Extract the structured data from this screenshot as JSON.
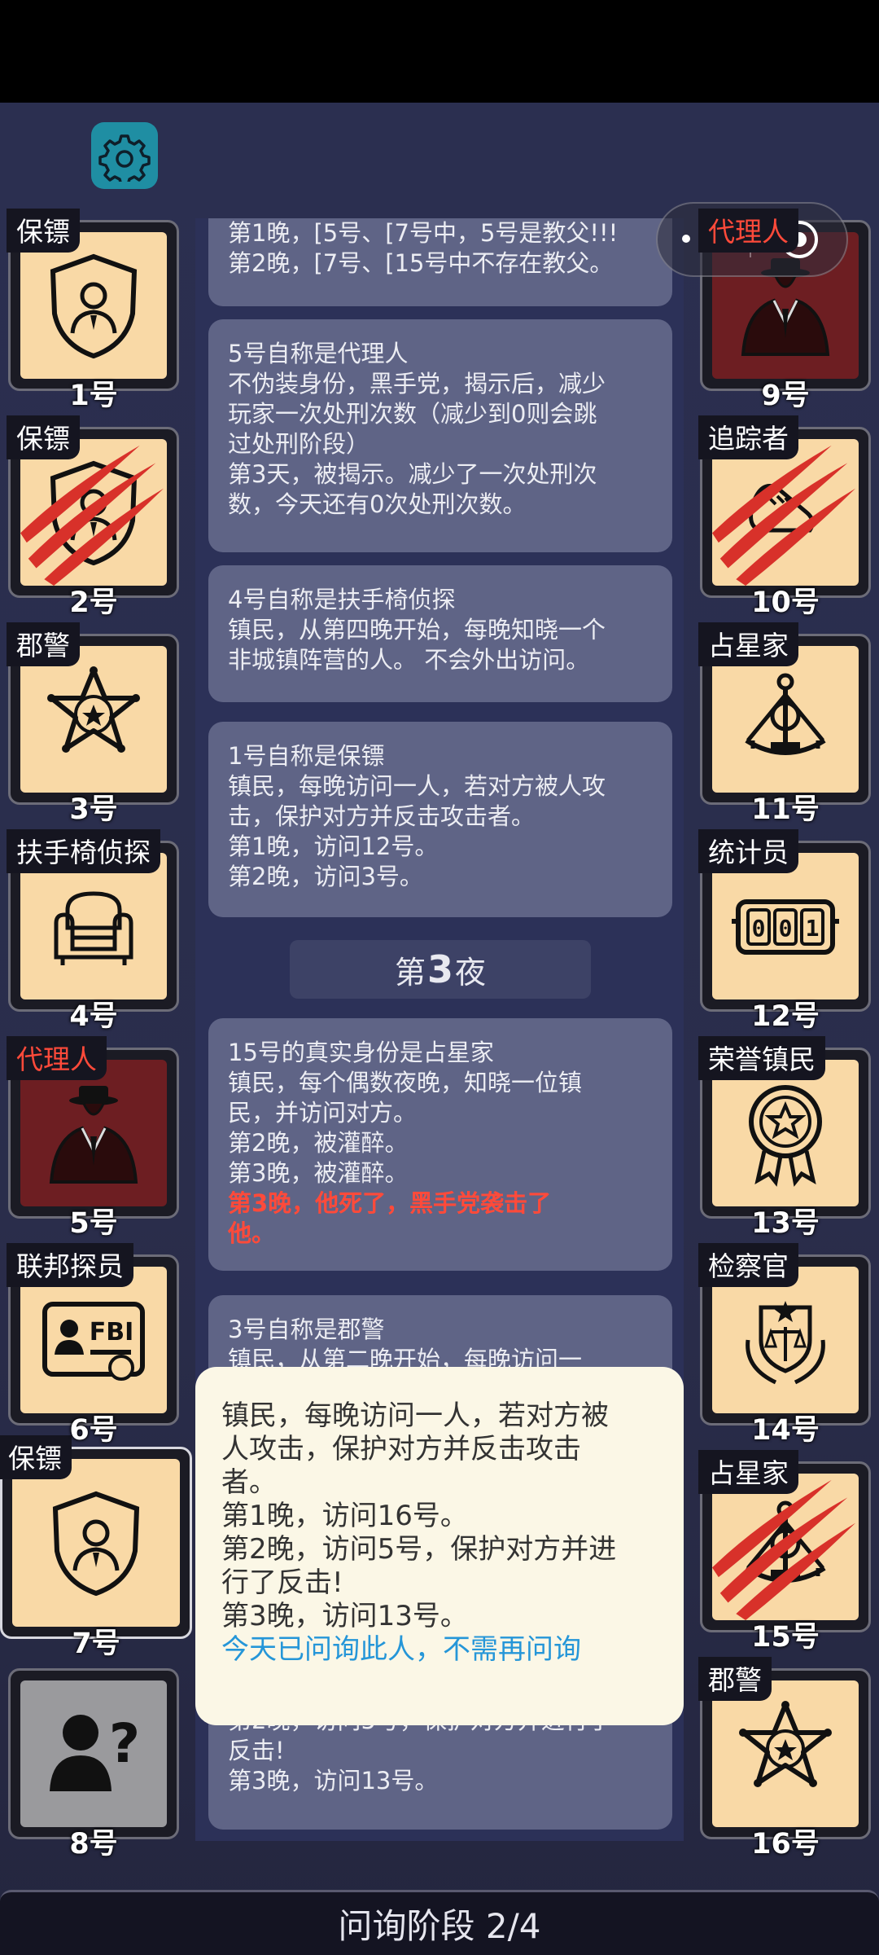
{
  "settings": {
    "icon": "gear-icon"
  },
  "capsule": {
    "menu_icon": "more-dots-icon",
    "close_icon": "record-icon"
  },
  "players_left": [
    {
      "role": "保镖",
      "number": "1号",
      "icon": "bodyguard-shield-icon",
      "role_color": "white",
      "bg": "light",
      "clawed": false
    },
    {
      "role": "保镖",
      "number": "2号",
      "icon": "bodyguard-shield-icon",
      "role_color": "white",
      "bg": "light",
      "clawed": true
    },
    {
      "role": "郡警",
      "number": "3号",
      "icon": "sheriff-badge-icon",
      "role_color": "white",
      "bg": "light",
      "clawed": false
    },
    {
      "role": "扶手椅侦探",
      "number": "4号",
      "icon": "armchair-icon",
      "role_color": "white",
      "bg": "light",
      "clawed": false
    },
    {
      "role": "代理人",
      "number": "5号",
      "icon": "mafia-agent-icon",
      "role_color": "red",
      "bg": "dark",
      "clawed": false
    },
    {
      "role": "联邦探员",
      "number": "6号",
      "icon": "fbi-badge-icon",
      "role_color": "white",
      "bg": "light",
      "clawed": false
    },
    {
      "role": "保镖",
      "number": "7号",
      "icon": "bodyguard-shield-icon",
      "role_color": "white",
      "bg": "light",
      "clawed": false
    },
    {
      "role": "",
      "number": "8号",
      "icon": "unknown-person-icon",
      "role_color": "white",
      "bg": "grey",
      "clawed": false
    }
  ],
  "players_right": [
    {
      "role": "代理人",
      "number": "9号",
      "icon": "mafia-agent-icon",
      "role_color": "red",
      "bg": "dark",
      "clawed": false
    },
    {
      "role": "追踪者",
      "number": "10号",
      "icon": "tracker-shoes-icon",
      "role_color": "white",
      "bg": "light",
      "clawed": true
    },
    {
      "role": "占星家",
      "number": "11号",
      "icon": "sextant-icon",
      "role_color": "white",
      "bg": "light",
      "clawed": false
    },
    {
      "role": "统计员",
      "number": "12号",
      "icon": "counter-icon",
      "role_color": "white",
      "bg": "light",
      "clawed": false
    },
    {
      "role": "荣誉镇民",
      "number": "13号",
      "icon": "medal-icon",
      "role_color": "white",
      "bg": "light",
      "clawed": false
    },
    {
      "role": "检察官",
      "number": "14号",
      "icon": "justice-scales-icon",
      "role_color": "white",
      "bg": "light",
      "clawed": false
    },
    {
      "role": "占星家",
      "number": "15号",
      "icon": "sextant-icon",
      "role_color": "white",
      "bg": "light",
      "clawed": true
    },
    {
      "role": "郡警",
      "number": "16号",
      "icon": "sheriff-badge-icon",
      "role_color": "white",
      "bg": "light",
      "clawed": false
    }
  ],
  "feed": {
    "card1": [
      "第1晚，[5号、[7号中，5号是教父!!!",
      "第2晚，[7号、[15号中不存在教父。"
    ],
    "card2": [
      "5号自称是代理人",
      "不伪装身份，黑手党，揭示后，减少",
      "玩家一次处刑次数（减少到0则会跳",
      "过处刑阶段）",
      "第3天，被揭示。减少了一次处刑次",
      "数，今天还有0次处刑次数。"
    ],
    "card3": [
      "4号自称是扶手椅侦探",
      "镇民，从第四晚开始，每晚知晓一个",
      "非城镇阵营的人。 不会外出访问。"
    ],
    "card4": [
      "1号自称是保镖",
      "镇民，每晚访问一人，若对方被人攻",
      "击，保护对方并反击攻击者。",
      "第1晚，访问12号。",
      "第2晚，访问3号。"
    ],
    "night_prefix": "第",
    "night_number": "3",
    "night_suffix": "夜",
    "card5": [
      "15号的真实身份是占星家",
      "镇民，每个偶数夜晚，知晓一位镇",
      "民，并访问对方。",
      "第2晚，被灌醉。",
      "第3晚，被灌醉。"
    ],
    "card5_red": [
      "第3晚，他死了，黑手党袭击了",
      "他。"
    ],
    "card6": [
      "3号自称是郡警",
      "镇民，从第二晚开始，每晚访问一"
    ],
    "card7": [
      "第2晚，访问5号，保护对方并进行了",
      "反击!",
      "第3晚，访问13号。"
    ]
  },
  "tooltip": {
    "lines": [
      "镇民，每晚访问一人，若对方被",
      "人攻击，保护对方并反击攻击",
      "者。",
      "第1晚，访问16号。",
      "第2晚，访问5号，保护对方并进",
      "行了反击!",
      "第3晚，访问13号。"
    ],
    "note": "今天已问询此人，不需再问询"
  },
  "phase": {
    "label": "问询阶段 2/4"
  },
  "colors": {
    "accent_teal": "#1f8ea3",
    "mafia_red": "#ff4a3a",
    "info_blue": "#2596d8",
    "card_bg": "#f9d9a6"
  }
}
